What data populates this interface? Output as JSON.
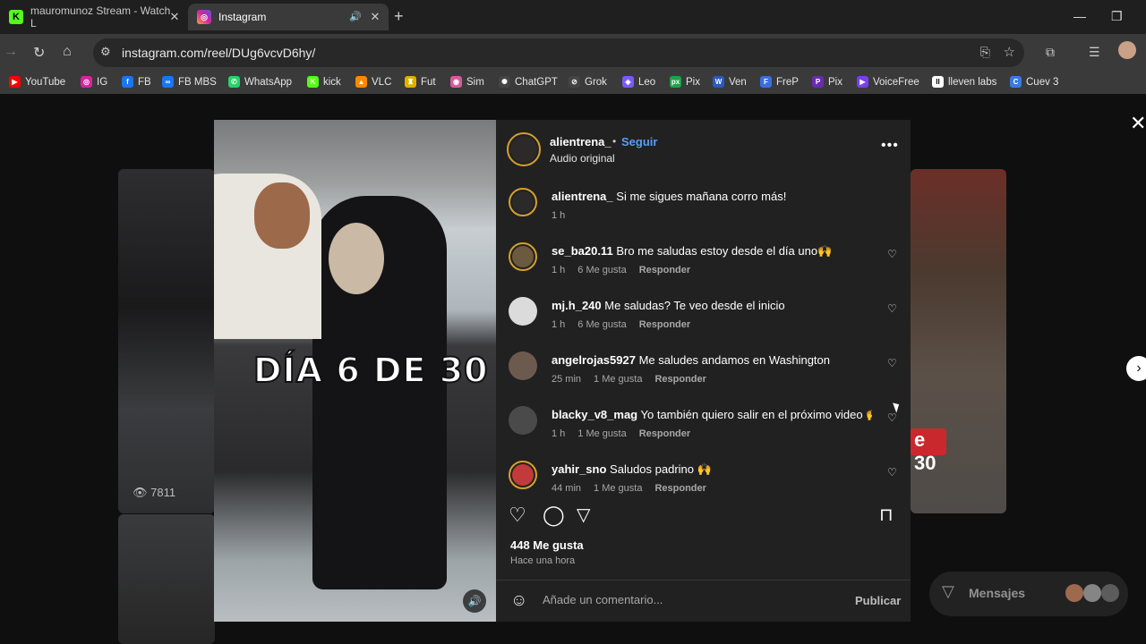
{
  "browser": {
    "tabs": [
      {
        "title": "mauromunoz Stream - Watch L",
        "favicon": "K",
        "favicon_color": "#53fc18"
      },
      {
        "title": "Instagram",
        "favicon": "IG",
        "favicon_color": "#d6249f"
      }
    ],
    "url": "instagram.com/reel/DUg6vcvD6hy/",
    "bookmarks": [
      {
        "label": "YouTube",
        "color": "#ff0000",
        "glyph": "▶"
      },
      {
        "label": "IG",
        "color": "#d6249f",
        "glyph": "◎"
      },
      {
        "label": "FB",
        "color": "#1877f2",
        "glyph": "f"
      },
      {
        "label": "FB MBS",
        "color": "#1877f2",
        "glyph": "∞"
      },
      {
        "label": "WhatsApp",
        "color": "#25d366",
        "glyph": "✆"
      },
      {
        "label": "kick",
        "color": "#53fc18",
        "glyph": "K"
      },
      {
        "label": "VLC",
        "color": "#ff8800",
        "glyph": "▲"
      },
      {
        "label": "Fut",
        "color": "#e0b000",
        "glyph": "♜"
      },
      {
        "label": "Sim",
        "color": "#d85a9a",
        "glyph": "◉"
      },
      {
        "label": "ChatGPT",
        "color": "#444444",
        "glyph": "✺"
      },
      {
        "label": "Grok",
        "color": "#444444",
        "glyph": "⊘"
      },
      {
        "label": "Leo",
        "color": "#7a5af8",
        "glyph": "◈"
      },
      {
        "label": "Pix",
        "color": "#1fa34a",
        "glyph": "px"
      },
      {
        "label": "Ven",
        "color": "#2b59c3",
        "glyph": "W"
      },
      {
        "label": "FreP",
        "color": "#3b6fe0",
        "glyph": "F"
      },
      {
        "label": "Pix",
        "color": "#6a2bb3",
        "glyph": "P"
      },
      {
        "label": "VoiceFree",
        "color": "#7a3ff0",
        "glyph": "▶"
      },
      {
        "label": "lleven labs",
        "color": "#ffffff",
        "glyph": "II"
      },
      {
        "label": "Cuev 3",
        "color": "#3a7be0",
        "glyph": "C"
      }
    ]
  },
  "background": {
    "left_views": "7811",
    "right_badge": "e 30"
  },
  "video": {
    "caption": "DÍA 6 DE 30"
  },
  "post": {
    "username": "alientrena_",
    "dot": "•",
    "follow_label": "Seguir",
    "audio": "Audio original",
    "comments": [
      {
        "user": "alientrena_",
        "text": "Si me sigues mañana corro más!",
        "time": "1 h",
        "likes": "",
        "reply": "",
        "avatar_color": "#2b2a29",
        "ring": true,
        "heart": false
      },
      {
        "user": "se_ba20.11",
        "text": "Bro me saludas estoy desde el día uno🙌",
        "time": "1 h",
        "likes": "6 Me gusta",
        "reply": "Responder",
        "avatar_color": "#6b5a3e",
        "ring": true,
        "heart": true
      },
      {
        "user": "mj.h_240",
        "text": "Me saludas? Te veo desde el inicio",
        "time": "1 h",
        "likes": "6 Me gusta",
        "reply": "Responder",
        "avatar_color": "#dbdbdb",
        "ring": false,
        "heart": true
      },
      {
        "user": "angelrojas5927",
        "text": "Me saludes andamos en Washington",
        "time": "25 min",
        "likes": "1 Me gusta",
        "reply": "Responder",
        "avatar_color": "#6d5a4f",
        "ring": false,
        "heart": true
      },
      {
        "user": "blacky_v8_mag",
        "text": "Yo también quiero salir en el próximo video 🙌",
        "time": "1 h",
        "likes": "1 Me gusta",
        "reply": "Responder",
        "avatar_color": "#4a4a4a",
        "ring": false,
        "heart": true
      },
      {
        "user": "yahir_sno",
        "text": "Saludos padrino 🙌",
        "time": "44 min",
        "likes": "1 Me gusta",
        "reply": "Responder",
        "avatar_color": "#c23a3a",
        "ring": true,
        "heart": true
      }
    ],
    "likes_count": "448 Me gusta",
    "time_ago": "Hace una hora",
    "comment_placeholder": "Añade un comentario...",
    "publish_label": "Publicar"
  },
  "messages": {
    "label": "Mensajes"
  }
}
